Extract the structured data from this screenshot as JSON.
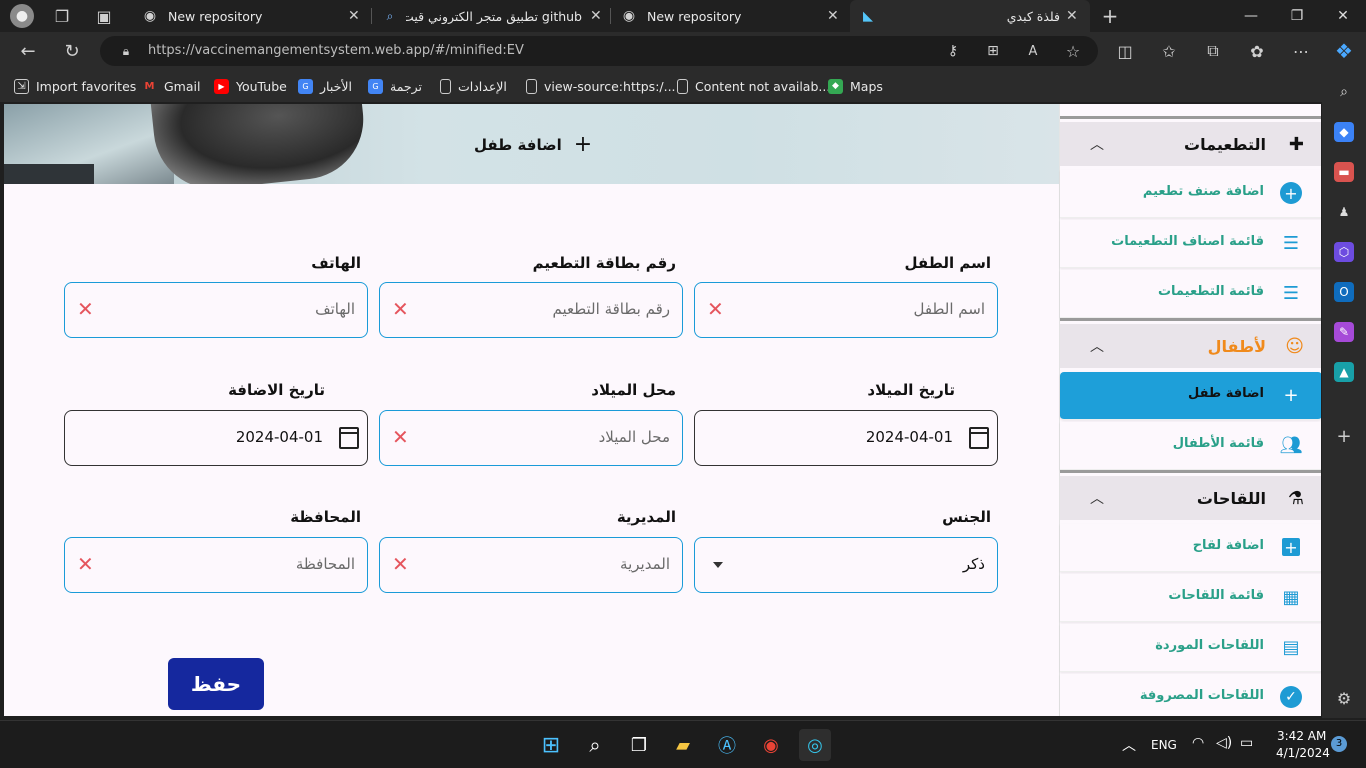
{
  "browser": {
    "tabs": [
      {
        "title": "New repository",
        "icon": "github-icon"
      },
      {
        "title": "github تطبيق متجر الكتروني قيت هب",
        "icon": "search-icon"
      },
      {
        "title": "New repository",
        "icon": "github-icon"
      },
      {
        "title": "فلذة كبدي",
        "icon": "flutter-icon"
      }
    ],
    "url": "https://vaccinemangementsystem.web.app/#/minified:EV",
    "favorites": [
      {
        "label": "Import favorites"
      },
      {
        "label": "Gmail"
      },
      {
        "label": "YouTube"
      },
      {
        "label": "الأخبار"
      },
      {
        "label": "ترجمة"
      },
      {
        "label": "الإعدادات"
      },
      {
        "label": "view-source:https:/..."
      },
      {
        "label": "Content not availab..."
      },
      {
        "label": "Maps"
      }
    ]
  },
  "header": {
    "add_child": "اضافة طفل"
  },
  "form": {
    "child_name": {
      "label": "اسم الطفل",
      "placeholder": "اسم الطفل"
    },
    "vaccine_card": {
      "label": "رقم بطاقة التطعيم",
      "placeholder": "رقم بطاقة التطعيم"
    },
    "phone": {
      "label": "الهاتف",
      "placeholder": "الهاتف"
    },
    "birth_date": {
      "label": "تاريخ الميلاد",
      "value": "2024-04-01"
    },
    "birth_place": {
      "label": "محل الميلاد",
      "placeholder": "محل الميلاد"
    },
    "add_date": {
      "label": "تاريخ الاضافة",
      "value": "2024-04-01"
    },
    "gender": {
      "label": "الجنس",
      "value": "ذكر"
    },
    "directorate": {
      "label": "المديرية",
      "placeholder": "المديرية"
    },
    "governorate": {
      "label": "المحافظة",
      "placeholder": "المحافظة"
    },
    "save": "حفظ"
  },
  "nav": {
    "vaccinations": {
      "title": "التطعيمات",
      "items": [
        "اضافة صنف تطعيم",
        "قائمة اصناف التطعيمات",
        "قائمة التطعيمات"
      ]
    },
    "children": {
      "title": "لأطفال",
      "items": [
        "اضافة طفل",
        "قائمة الأطفال"
      ]
    },
    "vaccines": {
      "title": "اللقاحات",
      "items": [
        "اضافة لقاح",
        "قائمة اللقاحات",
        "اللقاحات الموردة",
        "اللقاحات المصروفة"
      ]
    }
  },
  "colors": {
    "accent": "#1e9fd9",
    "nav_text": "#2aa089",
    "children_title": "#f08a1c",
    "save_btn": "#15289e",
    "clear_x": "#e5555d"
  },
  "taskbar": {
    "lang": "ENG",
    "time": "3:42 AM",
    "date": "4/1/2024",
    "badge": "3"
  }
}
